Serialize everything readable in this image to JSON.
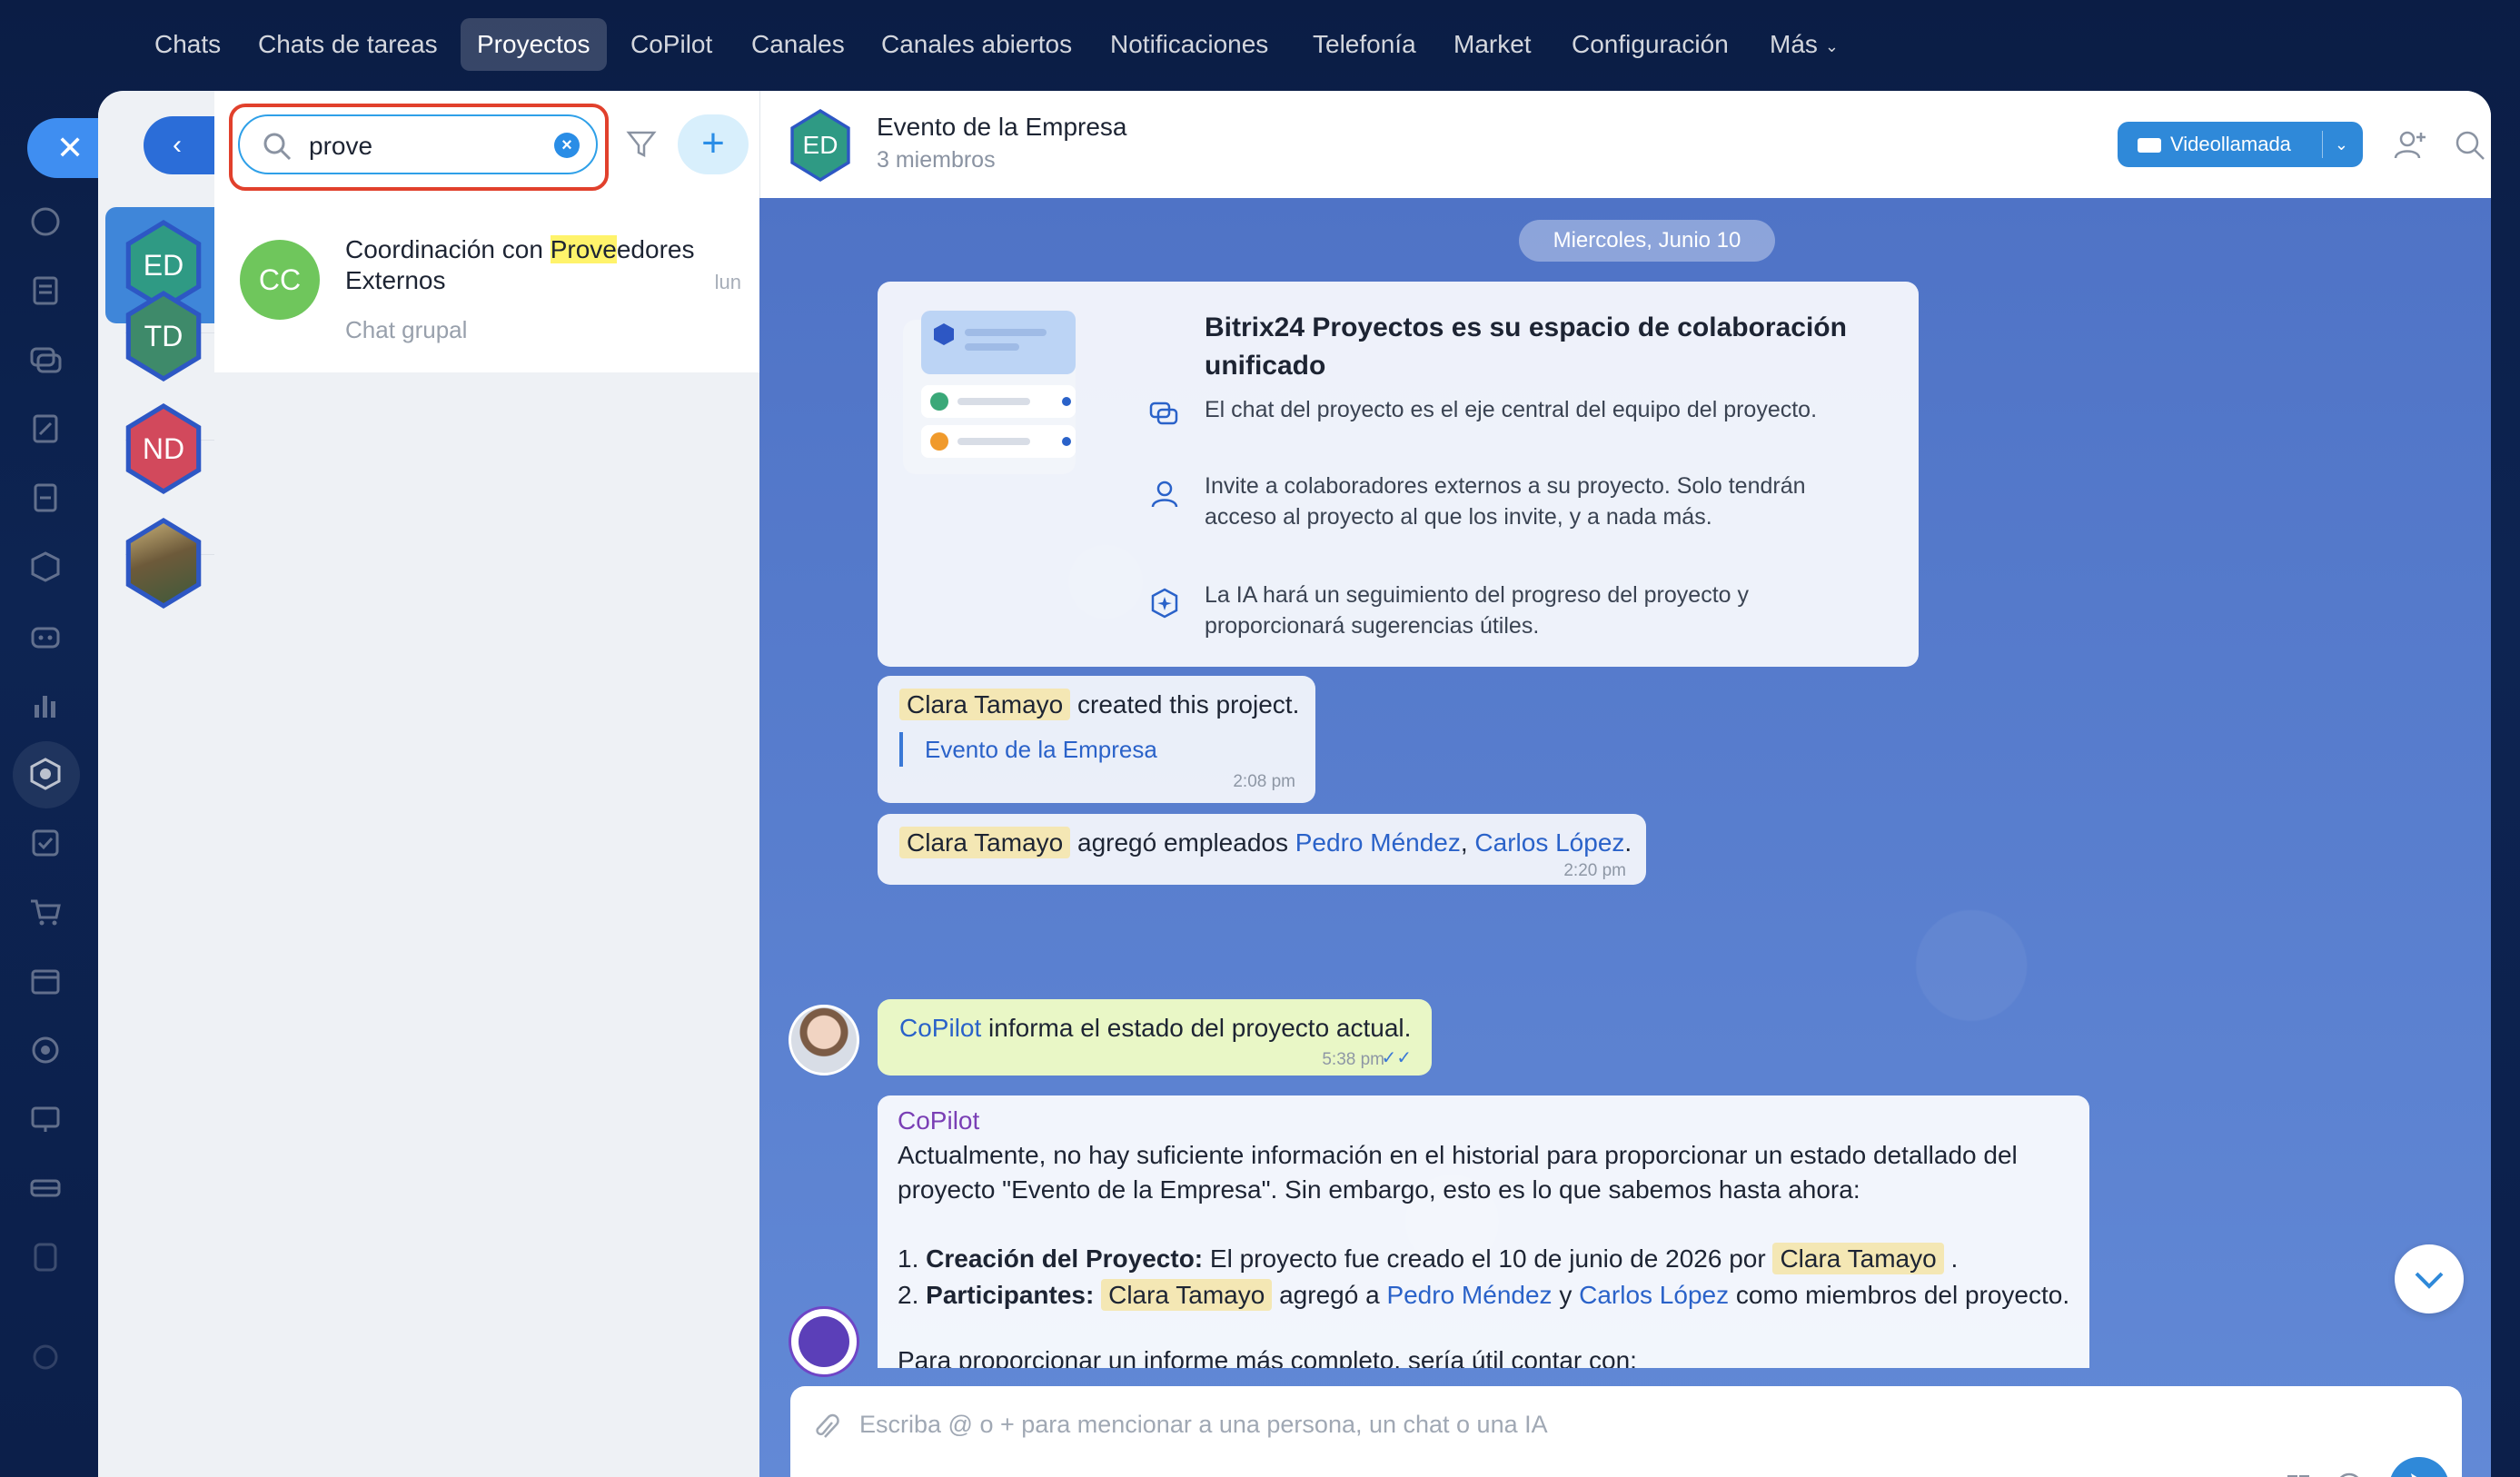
{
  "topnav": {
    "items": [
      "Chats",
      "Chats de tareas",
      "Proyectos",
      "CoPilot",
      "Canales",
      "Canales abiertos",
      "Notificaciones",
      "Telefonía",
      "Market",
      "Configuración",
      "Más"
    ],
    "active": "Proyectos"
  },
  "recents": {
    "items": [
      {
        "initials": "ED",
        "color": "#2f9a84"
      },
      {
        "initials": "TD",
        "color": "#3e8a6a"
      },
      {
        "initials": "ND",
        "color": "#d2495c"
      },
      {
        "initials": "",
        "color": "#8a7a4a"
      }
    ]
  },
  "search": {
    "query": "prove",
    "results": [
      {
        "initials": "CC",
        "title_prefix": "Coordinación con ",
        "title_match": "Prove",
        "title_suffix": "edores Externos",
        "subtitle": "Chat grupal",
        "time": "lun"
      }
    ]
  },
  "chat": {
    "avatar": "ED",
    "name": "Evento de la Empresa",
    "members": "3 miembros",
    "video_label": "Videollamada",
    "date_pill": "Miercoles, Junio 10",
    "welcome": {
      "title": "Bitrix24 Proyectos es su espacio de colaboración unificado",
      "features": [
        "El chat del proyecto es el eje central del equipo del proyecto.",
        "Invite a colaboradores externos a su proyecto. Solo tendrán acceso al proyecto al que los invite, y a nada más.",
        "La IA hará un seguimiento del progreso del proyecto y proporcionará sugerencias útiles."
      ]
    },
    "messages": {
      "created": {
        "user": "Clara Tamayo",
        "text": "created this project.",
        "quote": "Evento de la Empresa",
        "time": "2:08 pm"
      },
      "added": {
        "user": "Clara Tamayo",
        "text": "agregó empleados",
        "p1": "Pedro Méndez",
        "comma": ",",
        "p2": "Carlos López",
        "dot": ".",
        "time": "2:20 pm"
      },
      "own": {
        "link": "CoPilot",
        "text": "informa el estado del proyecto actual.",
        "time": "5:38 pm"
      },
      "copilot": {
        "author": "CoPilot",
        "line1": "Actualmente, no hay suficiente información en el historial para proporcionar un estado detallado del",
        "line2": "proyecto \"Evento de la Empresa\". Sin embargo, esto es lo que sabemos hasta ahora:",
        "item1_num": "1.",
        "item1_bold": "Creación del Proyecto:",
        "item1_text": "El proyecto fue creado el 10 de junio de 2026 por",
        "item1_user": "Clara Tamayo",
        "item1_end": ".",
        "item2_num": "2.",
        "item2_bold": "Participantes:",
        "item2_user": "Clara Tamayo",
        "item2_text": "agregó a",
        "item2_p1": "Pedro Méndez",
        "item2_y": "y",
        "item2_p2": "Carlos López",
        "item2_end": "como miembros del proyecto.",
        "line_last": "Para proporcionar un informe más completo, sería útil contar con:"
      }
    },
    "composer_placeholder": "Escriba @ o + para mencionar a una persona, un chat o una IA"
  }
}
